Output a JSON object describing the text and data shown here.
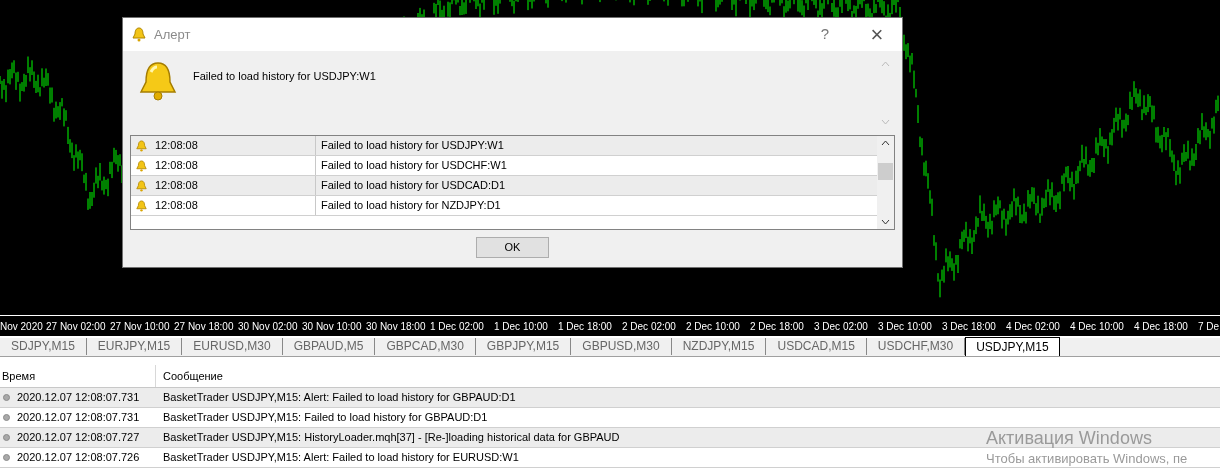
{
  "chart": {
    "time_axis": [
      "Nov 2020",
      "27 Nov 02:00",
      "27 Nov 10:00",
      "27 Nov 18:00",
      "30 Nov 02:00",
      "30 Nov 10:00",
      "30 Nov 18:00",
      "1 Dec 02:00",
      "1 Dec 10:00",
      "1 Dec 18:00",
      "2 Dec 02:00",
      "2 Dec 10:00",
      "2 Dec 18:00",
      "3 Dec 02:00",
      "3 Dec 10:00",
      "3 Dec 18:00",
      "4 Dec 02:00",
      "4 Dec 10:00",
      "4 Dec 18:00",
      "7 De"
    ]
  },
  "alert_dialog": {
    "title": "Алерт",
    "help": "?",
    "close": "×",
    "message": "Failed to load history for USDJPY:W1",
    "rows": [
      {
        "time": "12:08:08",
        "message": "Failed to load history for USDJPY:W1"
      },
      {
        "time": "12:08:08",
        "message": "Failed to load history for USDCHF:W1"
      },
      {
        "time": "12:08:08",
        "message": "Failed to load history for USDCAD:D1"
      },
      {
        "time": "12:08:08",
        "message": "Failed to load history for NZDJPY:D1"
      }
    ],
    "ok_button": "OK"
  },
  "chart_tabs": [
    {
      "label": "SDJPY,M15",
      "selected": false
    },
    {
      "label": "EURJPY,M15",
      "selected": false
    },
    {
      "label": "EURUSD,M30",
      "selected": false
    },
    {
      "label": "GBPAUD,M5",
      "selected": false
    },
    {
      "label": "GBPCAD,M30",
      "selected": false
    },
    {
      "label": "GBPJPY,M15",
      "selected": false
    },
    {
      "label": "GBPUSD,M30",
      "selected": false
    },
    {
      "label": "NZDJPY,M15",
      "selected": false
    },
    {
      "label": "USDCAD,M15",
      "selected": false
    },
    {
      "label": "USDCHF,M30",
      "selected": false
    },
    {
      "label": "USDJPY,M15",
      "selected": true
    }
  ],
  "journal": {
    "columns": [
      "Время",
      "Сообщение"
    ],
    "rows": [
      {
        "time": "2020.12.07 12:08:07.731",
        "message": "BasketTrader USDJPY,M15: Alert: Failed to load history for GBPAUD:D1"
      },
      {
        "time": "2020.12.07 12:08:07.731",
        "message": "BasketTrader USDJPY,M15: Failed to load history for GBPAUD:D1"
      },
      {
        "time": "2020.12.07 12:08:07.727",
        "message": "BasketTrader USDJPY,M15: HistoryLoader.mqh[37] - [Re-]loading historical data for GBPAUD"
      },
      {
        "time": "2020.12.07 12:08:07.726",
        "message": "BasketTrader USDJPY,M15: Alert: Failed to load history for EURUSD:W1"
      }
    ]
  },
  "os_notice": {
    "title": "Активация Windows",
    "text": "Чтобы активировать Windows, пе"
  }
}
